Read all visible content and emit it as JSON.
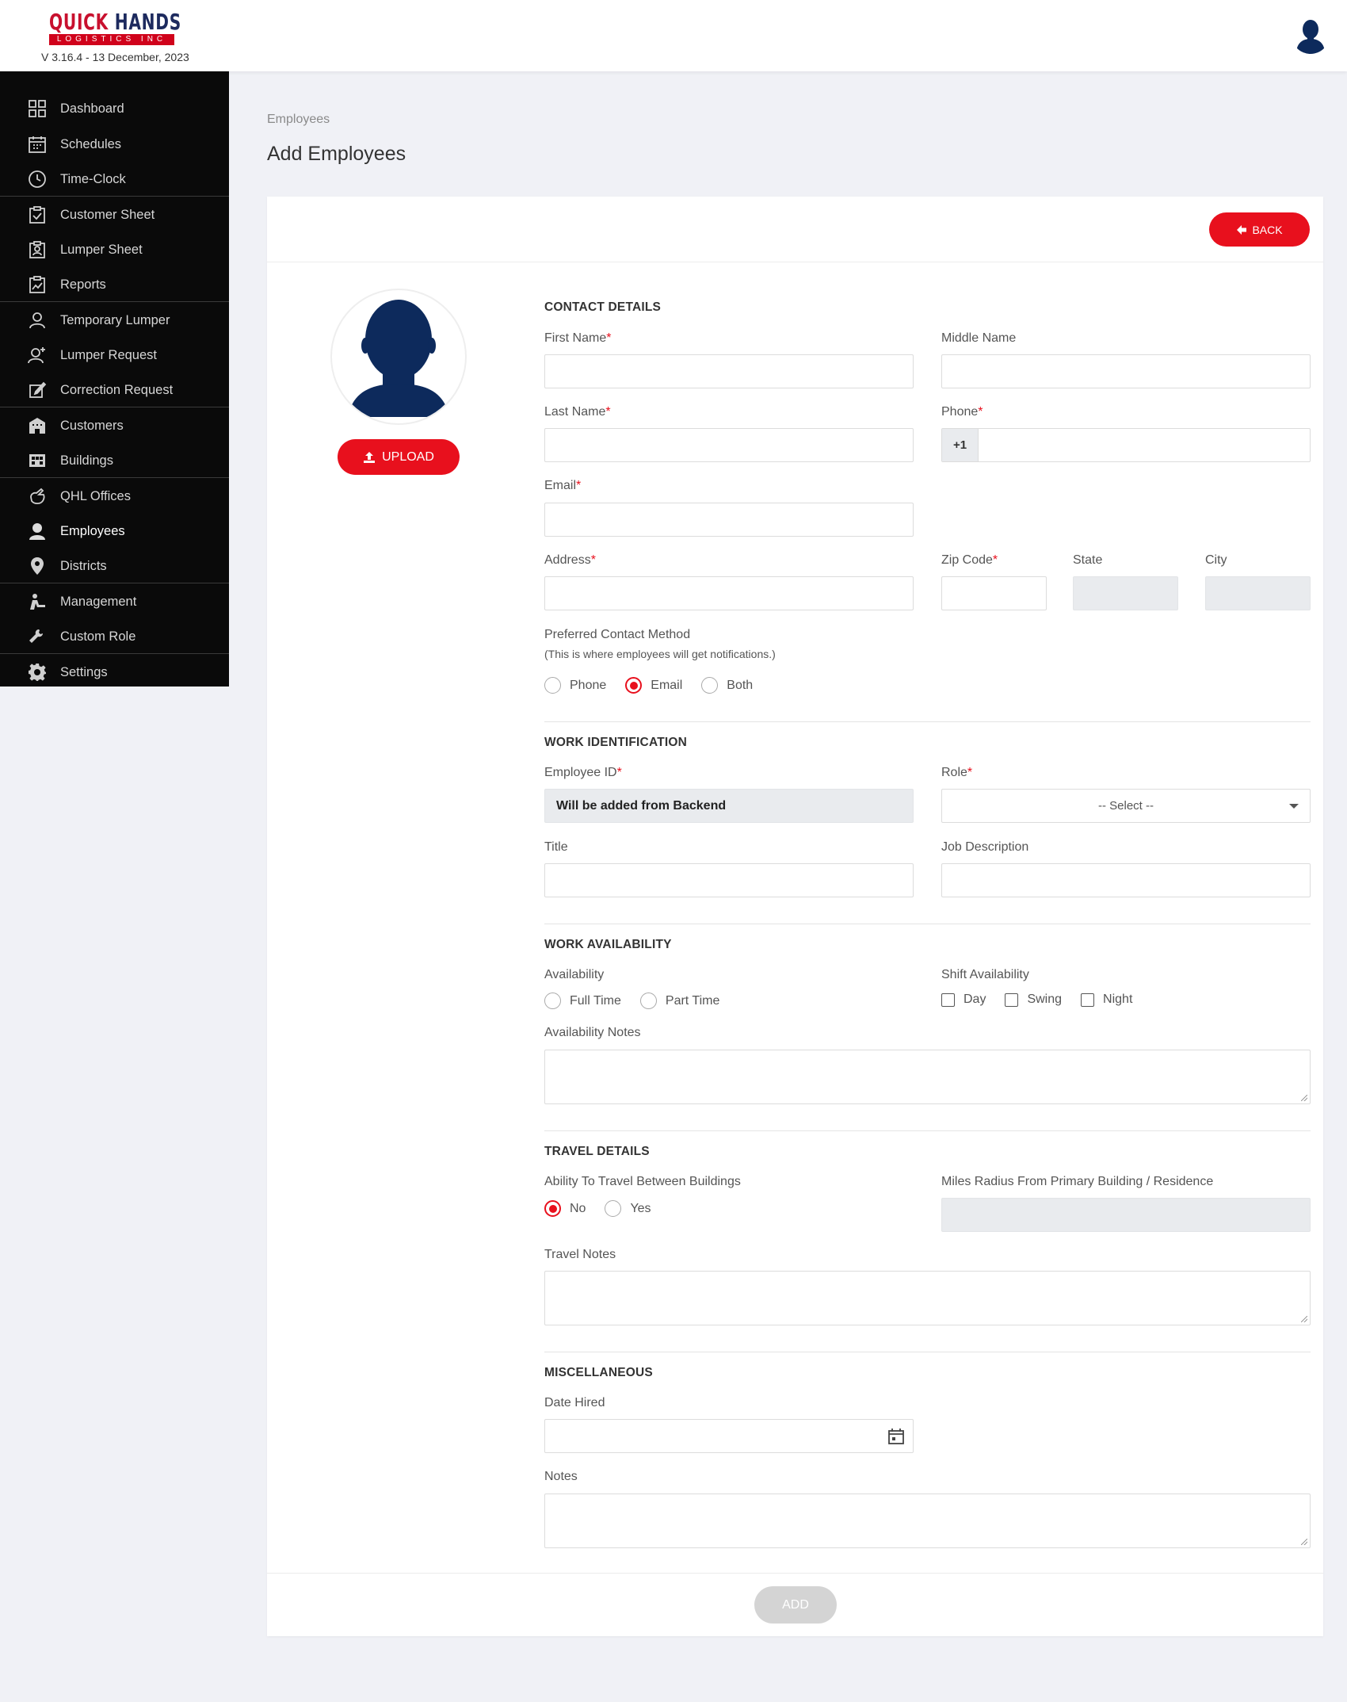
{
  "brand": {
    "logo_main_1": "QUICK ",
    "logo_main_2": "HANDS",
    "logo_sub": "LOGISTICS INC",
    "version": "V 3.16.4 - 13 December, 2023"
  },
  "sidebar": {
    "items": [
      {
        "label": "Dashboard",
        "icon": "dashboard-icon"
      },
      {
        "label": "Schedules",
        "icon": "calendar-icon"
      },
      {
        "label": "Time-Clock",
        "icon": "clock-icon"
      },
      {
        "label": "Customer Sheet",
        "icon": "clipboard-check-icon"
      },
      {
        "label": "Lumper Sheet",
        "icon": "clipboard-user-icon"
      },
      {
        "label": "Reports",
        "icon": "chart-report-icon"
      },
      {
        "label": "Temporary Lumper",
        "icon": "user-outline-icon"
      },
      {
        "label": "Lumper Request",
        "icon": "user-plus-icon"
      },
      {
        "label": "Correction Request",
        "icon": "edit-icon"
      },
      {
        "label": "Customers",
        "icon": "building-icon"
      },
      {
        "label": "Buildings",
        "icon": "warehouse-icon"
      },
      {
        "label": "QHL Offices",
        "icon": "hand-icon"
      },
      {
        "label": "Employees",
        "icon": "user-icon"
      },
      {
        "label": "Districts",
        "icon": "map-pin-icon"
      },
      {
        "label": "Management",
        "icon": "management-icon"
      },
      {
        "label": "Custom Role",
        "icon": "wrench-icon"
      },
      {
        "label": "Settings",
        "icon": "gear-icon"
      }
    ],
    "active": "Employees"
  },
  "breadcrumb": "Employees",
  "page_title": "Add Employees",
  "buttons": {
    "back": "BACK",
    "upload": "UPLOAD",
    "add": "ADD"
  },
  "contact": {
    "title": "CONTACT DETAILS",
    "first_name": "First Name",
    "middle_name": "Middle Name",
    "last_name": "Last Name",
    "phone": "Phone",
    "phone_prefix": "+1",
    "email": "Email",
    "address": "Address",
    "zip": "Zip Code",
    "state": "State",
    "city": "City",
    "preferred": "Preferred Contact Method",
    "preferred_hint": "(This is where employees will get notifications.)",
    "methods": [
      "Phone",
      "Email",
      "Both"
    ],
    "selected_method": "Email",
    "required_mark": "*"
  },
  "work_id": {
    "title": "WORK IDENTIFICATION",
    "employee_id": "Employee ID",
    "employee_id_value": "Will be added from Backend",
    "role": "Role",
    "role_placeholder": "-- Select --",
    "title_label": "Title",
    "job_description": "Job Description"
  },
  "availability": {
    "title": "WORK AVAILABILITY",
    "availability": "Availability",
    "options": [
      "Full Time",
      "Part Time"
    ],
    "shift": "Shift Availability",
    "shifts": [
      "Day",
      "Swing",
      "Night"
    ],
    "notes": "Availability Notes"
  },
  "travel": {
    "title": "TRAVEL DETAILS",
    "ability": "Ability To Travel Between Buildings",
    "options": [
      "No",
      "Yes"
    ],
    "selected": "No",
    "miles": "Miles Radius From Primary Building / Residence",
    "notes": "Travel Notes"
  },
  "misc": {
    "title": "MISCELLANEOUS",
    "date_hired": "Date Hired",
    "notes": "Notes"
  },
  "colors": {
    "accent": "#e8101d",
    "sidebar_bg": "#0a0a0a",
    "avatar": "#0d2a5c"
  }
}
